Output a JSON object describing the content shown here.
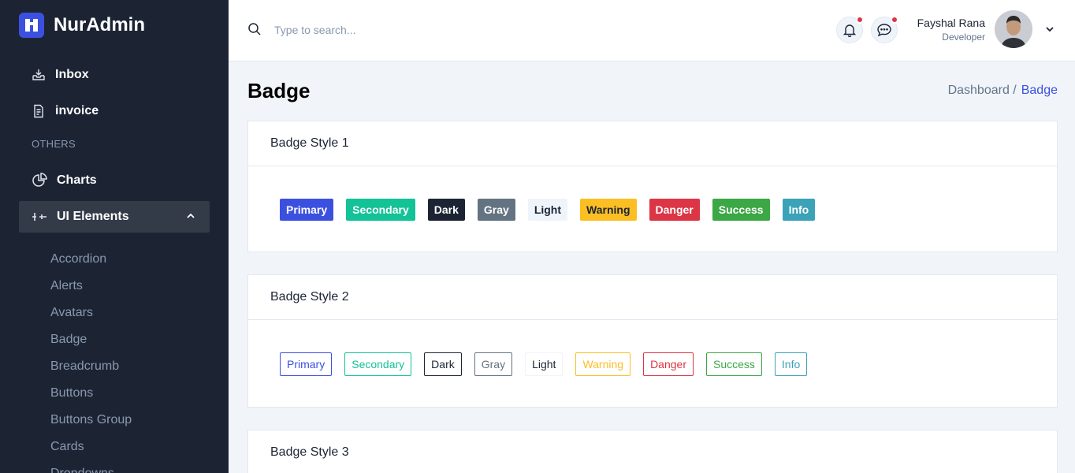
{
  "brand": {
    "name": "NurAdmin"
  },
  "sidebar": {
    "top_items": [
      {
        "label": "Inbox"
      },
      {
        "label": "invoice"
      }
    ],
    "section_label": "OTHERS",
    "others": [
      {
        "label": "Charts"
      },
      {
        "label": "UI Elements"
      }
    ],
    "sub_items": [
      {
        "label": "Accordion"
      },
      {
        "label": "Alerts"
      },
      {
        "label": "Avatars"
      },
      {
        "label": "Badge"
      },
      {
        "label": "Breadcrumb"
      },
      {
        "label": "Buttons"
      },
      {
        "label": "Buttons Group"
      },
      {
        "label": "Cards"
      },
      {
        "label": "Dropdowns"
      }
    ]
  },
  "header": {
    "search": {
      "placeholder": "Type to search..."
    },
    "user": {
      "name": "Fayshal Rana",
      "role": "Developer"
    }
  },
  "page": {
    "title": "Badge",
    "breadcrumb": {
      "parent": "Dashboard /",
      "current": "Badge"
    }
  },
  "cards": [
    {
      "title": "Badge Style 1",
      "badges": [
        {
          "label": "Primary",
          "bg": "#3c50e0",
          "fg": "#ffffff"
        },
        {
          "label": "Secondary",
          "bg": "#13c296",
          "fg": "#ffffff"
        },
        {
          "label": "Dark",
          "bg": "#1c2434",
          "fg": "#ffffff"
        },
        {
          "label": "Gray",
          "bg": "#637381",
          "fg": "#ffffff"
        },
        {
          "label": "Light",
          "bg": "#eff4fb",
          "fg": "#1c2434"
        },
        {
          "label": "Warning",
          "bg": "#fbbf24",
          "fg": "#1c2434"
        },
        {
          "label": "Danger",
          "bg": "#dc3545",
          "fg": "#ffffff"
        },
        {
          "label": "Success",
          "bg": "#3ca745",
          "fg": "#ffffff"
        },
        {
          "label": "Info",
          "bg": "#3ba2b8",
          "fg": "#ffffff"
        }
      ]
    },
    {
      "title": "Badge Style 2",
      "badges": [
        {
          "label": "Primary",
          "color": "#3c50e0"
        },
        {
          "label": "Secondary",
          "color": "#13c296"
        },
        {
          "label": "Dark",
          "color": "#1c2434"
        },
        {
          "label": "Gray",
          "color": "#637381"
        },
        {
          "label": "Light",
          "color": "#1c2434",
          "border": "#eff4fb"
        },
        {
          "label": "Warning",
          "color": "#fbbf24"
        },
        {
          "label": "Danger",
          "color": "#dc3545"
        },
        {
          "label": "Success",
          "color": "#3ca745"
        },
        {
          "label": "Info",
          "color": "#3ba2b8"
        }
      ]
    },
    {
      "title": "Badge Style 3"
    }
  ]
}
